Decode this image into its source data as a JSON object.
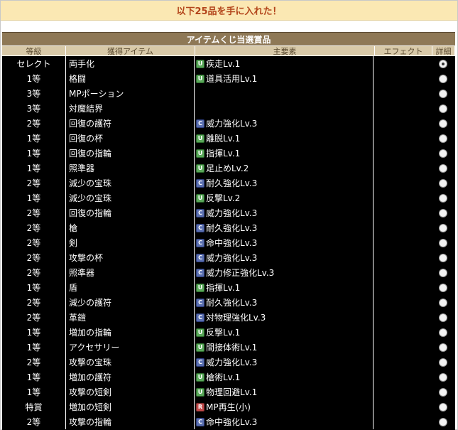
{
  "banner": {
    "text": "以下25品を手に入れた！"
  },
  "panel": {
    "title": "アイテムくじ当選賞品",
    "headers": {
      "grade": "等級",
      "item": "獲得アイテム",
      "element": "主要素",
      "effect": "エフェクト",
      "details": "詳細"
    }
  },
  "rows": [
    {
      "grade": "セレクト",
      "item": "両手化",
      "tag": "U",
      "element": "疾走Lv.1",
      "selected": true
    },
    {
      "grade": "1等",
      "item": "格闘",
      "tag": "U",
      "element": "道具活用Lv.1",
      "selected": false
    },
    {
      "grade": "3等",
      "item": "MPポーション",
      "tag": "",
      "element": "",
      "selected": false
    },
    {
      "grade": "3等",
      "item": "対魔結界",
      "tag": "",
      "element": "",
      "selected": false
    },
    {
      "grade": "2等",
      "item": "回復の護符",
      "tag": "C",
      "element": "威力強化Lv.3",
      "selected": false
    },
    {
      "grade": "1等",
      "item": "回復の杯",
      "tag": "U",
      "element": "離脱Lv.1",
      "selected": false
    },
    {
      "grade": "1等",
      "item": "回復の指輪",
      "tag": "U",
      "element": "指揮Lv.1",
      "selected": false
    },
    {
      "grade": "1等",
      "item": "照準器",
      "tag": "U",
      "element": "足止めLv.2",
      "selected": false
    },
    {
      "grade": "2等",
      "item": "減少の宝珠",
      "tag": "C",
      "element": "耐久強化Lv.3",
      "selected": false
    },
    {
      "grade": "1等",
      "item": "減少の宝珠",
      "tag": "U",
      "element": "反撃Lv.2",
      "selected": false
    },
    {
      "grade": "2等",
      "item": "回復の指輪",
      "tag": "C",
      "element": "威力強化Lv.3",
      "selected": false
    },
    {
      "grade": "2等",
      "item": "槍",
      "tag": "C",
      "element": "耐久強化Lv.3",
      "selected": false
    },
    {
      "grade": "2等",
      "item": "剣",
      "tag": "C",
      "element": "命中強化Lv.3",
      "selected": false
    },
    {
      "grade": "2等",
      "item": "攻撃の杯",
      "tag": "C",
      "element": "威力強化Lv.3",
      "selected": false
    },
    {
      "grade": "2等",
      "item": "照準器",
      "tag": "C",
      "element": "威力修正強化Lv.3",
      "selected": false
    },
    {
      "grade": "1等",
      "item": "盾",
      "tag": "U",
      "element": "指揮Lv.1",
      "selected": false
    },
    {
      "grade": "2等",
      "item": "減少の護符",
      "tag": "C",
      "element": "耐久強化Lv.3",
      "selected": false
    },
    {
      "grade": "2等",
      "item": "革鎧",
      "tag": "C",
      "element": "対物理強化Lv.3",
      "selected": false
    },
    {
      "grade": "1等",
      "item": "増加の指輪",
      "tag": "U",
      "element": "反撃Lv.1",
      "selected": false
    },
    {
      "grade": "1等",
      "item": "アクセサリー",
      "tag": "U",
      "element": "間接体術Lv.1",
      "selected": false
    },
    {
      "grade": "2等",
      "item": "攻撃の宝珠",
      "tag": "C",
      "element": "威力強化Lv.3",
      "selected": false
    },
    {
      "grade": "1等",
      "item": "増加の護符",
      "tag": "U",
      "element": "槍術Lv.1",
      "selected": false
    },
    {
      "grade": "1等",
      "item": "攻撃の短剣",
      "tag": "U",
      "element": "物理回避Lv.1",
      "selected": false
    },
    {
      "grade": "特賞",
      "item": "増加の短剣",
      "tag": "R",
      "element": "MP再生(小)",
      "selected": false
    },
    {
      "grade": "2等",
      "item": "攻撃の指輪",
      "tag": "C",
      "element": "命中強化Lv.3",
      "selected": false
    }
  ]
}
